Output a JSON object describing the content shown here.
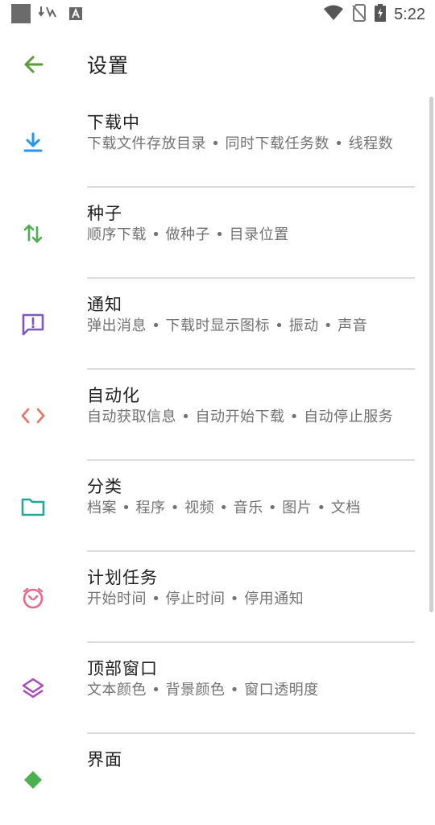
{
  "header": {
    "title": "设置"
  },
  "status_bar": {
    "time": "5:22"
  },
  "settings": [
    {
      "title": "下载中",
      "subtitle": "下载文件存放目录 • 同时下载任务数 • 线程数",
      "icon": "download-icon",
      "color": "#2196F3"
    },
    {
      "title": "种子",
      "subtitle": "顺序下载 • 做种子 • 目录位置",
      "icon": "swap-arrows-icon",
      "color": "#4CAF50"
    },
    {
      "title": "通知",
      "subtitle": "弹出消息 • 下载时显示图标 • 振动 • 声音",
      "icon": "notification-message-icon",
      "color": "#7E57C2"
    },
    {
      "title": "自动化",
      "subtitle": "自动获取信息 • 自动开始下载 • 自动停止服务",
      "icon": "code-brackets-icon",
      "color": "#E57366"
    },
    {
      "title": "分类",
      "subtitle": "档案 • 程序 • 视频 • 音乐 • 图片 • 文档",
      "icon": "folder-icon",
      "color": "#26A69A"
    },
    {
      "title": "计划任务",
      "subtitle": "开始时间 • 停止时间 • 停用通知",
      "icon": "schedule-timer-icon",
      "color": "#E56B8A"
    },
    {
      "title": "顶部窗口",
      "subtitle": "文本颜色 • 背景颜色 • 窗口透明度",
      "icon": "layers-icon",
      "color": "#AB47BC"
    },
    {
      "title": "界面",
      "subtitle": "",
      "icon": "interface-icon",
      "color": "#4CAF50"
    }
  ],
  "colors": {
    "back_arrow": "#5A9A3A",
    "divider": "#dcdcdc"
  }
}
